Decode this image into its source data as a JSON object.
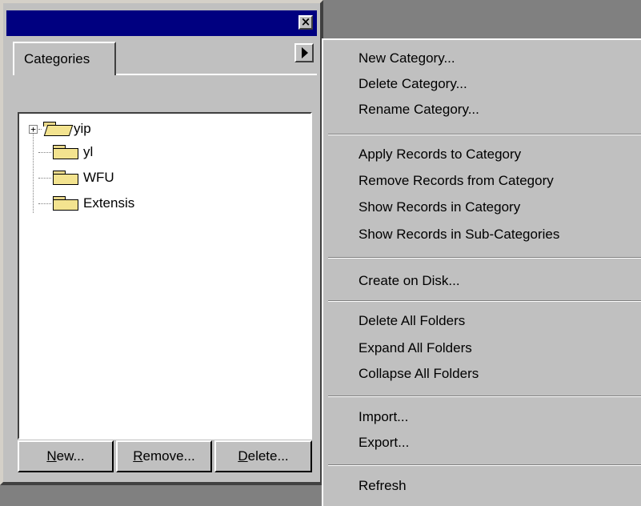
{
  "panel": {
    "close_glyph": "×",
    "tab_label": "Categories",
    "tree_items": [
      {
        "label": "yip",
        "expander": "+"
      },
      {
        "label": "yl"
      },
      {
        "label": "WFU"
      },
      {
        "label": "Extensis"
      }
    ],
    "buttons": {
      "new": {
        "mnemonic": "N",
        "rest": "ew..."
      },
      "remove": {
        "mnemonic": "R",
        "rest": "emove..."
      },
      "delete": {
        "mnemonic": "D",
        "rest": "elete..."
      }
    }
  },
  "menu": {
    "items": [
      "New Category...",
      "Delete Category...",
      "Rename Category...",
      "Apply Records to Category",
      "Remove Records from Category",
      "Show Records in Category",
      "Show Records in Sub-Categories",
      "Create on Disk...",
      "Delete All Folders",
      "Expand All Folders",
      "Collapse All Folders",
      "Import...",
      "Export...",
      "Refresh"
    ]
  }
}
